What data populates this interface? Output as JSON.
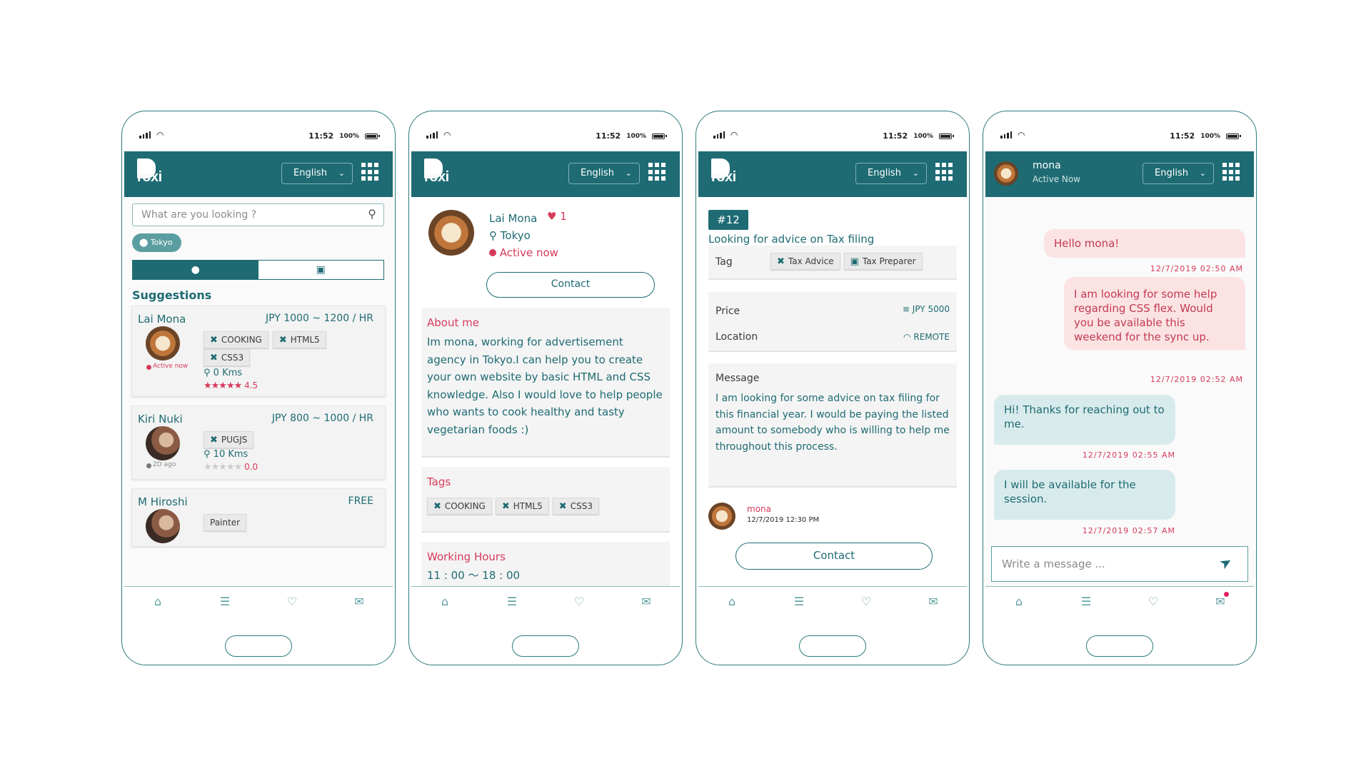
{
  "status": {
    "time": "11:52",
    "battery": "100%"
  },
  "header": {
    "brand": "roxi",
    "lang": "English"
  },
  "screen1": {
    "search_placeholder": "What are you looking ?",
    "location_chip": "Tokyo",
    "suggestions_title": "Suggestions",
    "cards": [
      {
        "name": "Lai Mona",
        "price": "JPY 1000 ~ 1200 / HR",
        "tags": [
          "COOKING",
          "HTML5",
          "CSS3"
        ],
        "status": "Active now",
        "distance": "0 Kms",
        "rating": "4.5"
      },
      {
        "name": "Kiri Nuki",
        "price": "JPY 800 ~ 1000 / HR",
        "tags": [
          "PUGJS"
        ],
        "status": "2D ago",
        "distance": "10 Kms",
        "rating": "0.0"
      },
      {
        "name": "M Hiroshi",
        "price": "FREE",
        "tags": [
          "Painter"
        ]
      }
    ]
  },
  "screen2": {
    "name": "Lai Mona",
    "likes": "1",
    "location": "Tokyo",
    "status": "Active now",
    "contact": "Contact",
    "about_title": "About me",
    "about_text": "Im mona, working for advertisement agency in Tokyo.I can help you to create your own website by basic HTML and CSS knowledge. Also I would love to help people who wants to cook healthy and tasty vegetarian foods :)",
    "tags_title": "Tags",
    "tags": [
      "COOKING",
      "HTML5",
      "CSS3"
    ],
    "hours_title": "Working Hours",
    "hours": "11 : 00 〜 18 : 00"
  },
  "screen3": {
    "id": "#12",
    "title": "Looking for advice on Tax filing",
    "tag_label": "Tag",
    "tags": [
      "Tax Advice",
      "Tax Preparer"
    ],
    "price_label": "Price",
    "price": "JPY 5000",
    "location_label": "Location",
    "location": "REMOTE",
    "message_label": "Message",
    "message": "I am looking for some advice on tax filing for this financial year. I would be paying the listed amount to somebody who is willing to help me throughout this process.",
    "poster": "mona",
    "posted_at": "12/7/2019 12:30 PM",
    "contact": "Contact"
  },
  "screen4": {
    "name": "mona",
    "status": "Active Now",
    "messages": [
      {
        "dir": "out",
        "text": "Hello mona!",
        "time": "12/7/2019 02:50 AM"
      },
      {
        "dir": "out",
        "text": "I am looking for some help regarding CSS flex. Would you be available this weekend for the sync up.",
        "time": "12/7/2019 02:52 AM"
      },
      {
        "dir": "in",
        "text": "Hi! Thanks for reaching out to me.",
        "time": "12/7/2019 02:55 AM"
      },
      {
        "dir": "in",
        "text": "I will be available for the session.",
        "time": "12/7/2019 02:57 AM"
      }
    ],
    "input_placeholder": "Write a message ..."
  },
  "colors": {
    "primary": "#1e6b73",
    "accent": "#d63a5a",
    "bubble_out": "#fbe3e4",
    "bubble_in": "#d8ebec"
  }
}
